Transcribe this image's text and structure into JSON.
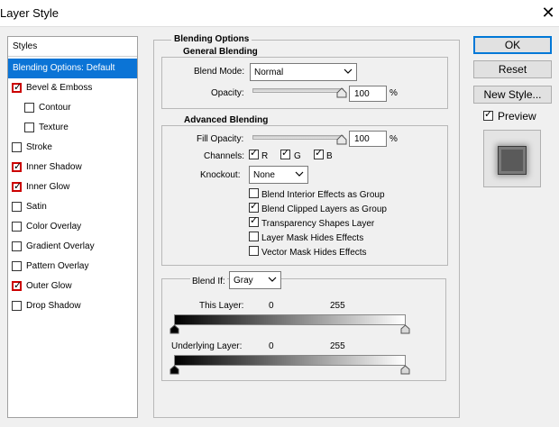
{
  "window": {
    "title": "Layer Style",
    "close_glyph": "✕"
  },
  "styles_panel": {
    "header": "Styles",
    "items": [
      {
        "label": "Blending Options: Default",
        "selected": true,
        "has_checkbox": false
      },
      {
        "label": "Bevel & Emboss",
        "checked": true
      },
      {
        "label": "Contour",
        "checked": false
      },
      {
        "label": "Texture",
        "checked": false
      },
      {
        "label": "Stroke",
        "checked": false
      },
      {
        "label": "Inner Shadow",
        "checked": true
      },
      {
        "label": "Inner Glow",
        "checked": true
      },
      {
        "label": "Satin",
        "checked": false
      },
      {
        "label": "Color Overlay",
        "checked": false
      },
      {
        "label": "Gradient Overlay",
        "checked": false
      },
      {
        "label": "Pattern Overlay",
        "checked": false
      },
      {
        "label": "Outer Glow",
        "checked": true
      },
      {
        "label": "Drop Shadow",
        "checked": false
      }
    ]
  },
  "blending": {
    "section_title": "Blending Options",
    "general_title": "General Blending",
    "blend_mode_label": "Blend Mode:",
    "blend_mode_value": "Normal",
    "opacity_label": "Opacity:",
    "opacity_value": "100",
    "opacity_unit": "%",
    "advanced_title": "Advanced Blending",
    "fill_opacity_label": "Fill Opacity:",
    "fill_opacity_value": "100",
    "fill_opacity_unit": "%",
    "channels_label": "Channels:",
    "channels": [
      {
        "label": "R",
        "checked": true
      },
      {
        "label": "G",
        "checked": true
      },
      {
        "label": "B",
        "checked": true
      }
    ],
    "knockout_label": "Knockout:",
    "knockout_value": "None",
    "options": [
      {
        "label": "Blend Interior Effects as Group",
        "checked": false
      },
      {
        "label": "Blend Clipped Layers as Group",
        "checked": true
      },
      {
        "label": "Transparency Shapes Layer",
        "checked": true
      },
      {
        "label": "Layer Mask Hides Effects",
        "checked": false
      },
      {
        "label": "Vector Mask Hides Effects",
        "checked": false
      }
    ],
    "blend_if_label": "Blend If:",
    "blend_if_value": "Gray",
    "this_layer_label": "This Layer:",
    "this_layer_min": "0",
    "this_layer_max": "255",
    "underlying_label": "Underlying Layer:",
    "underlying_min": "0",
    "underlying_max": "255"
  },
  "buttons": {
    "ok": "OK",
    "cancel": "Reset",
    "new_style": "New Style...",
    "preview_label": "Preview",
    "preview_checked": true
  },
  "colors": {
    "selection": "#0b74d6",
    "checkbox_highlight": "#cc0000",
    "default_button_border": "#0078d7"
  }
}
